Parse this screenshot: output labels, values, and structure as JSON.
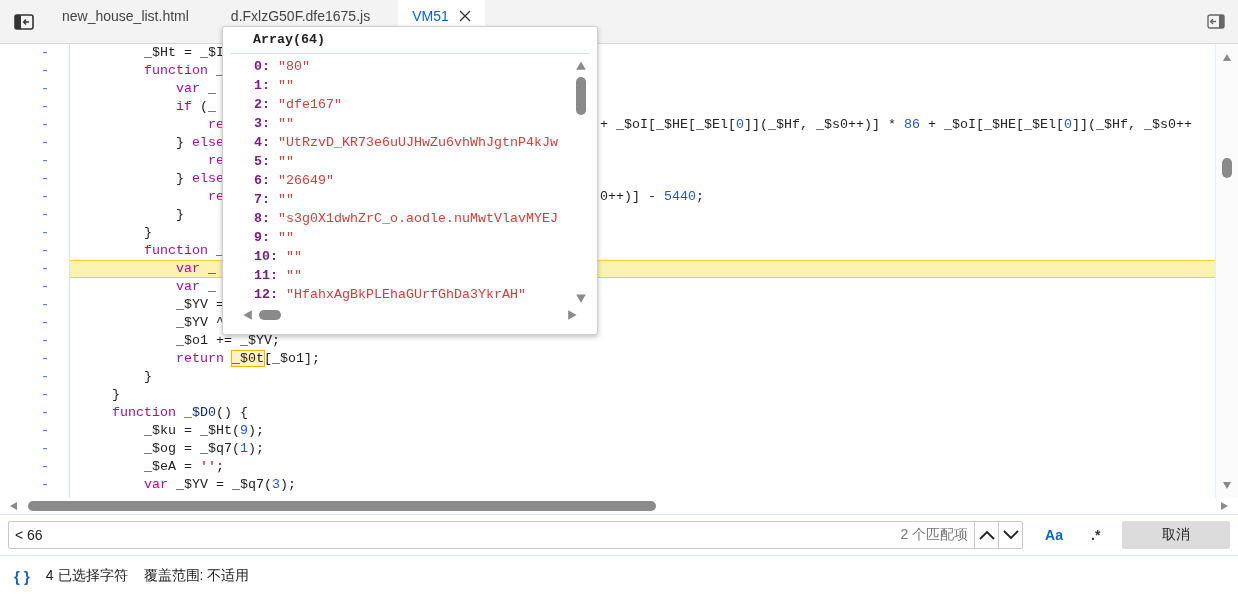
{
  "tabs": [
    {
      "label": "new_house_list.html",
      "selected": false,
      "closable": false
    },
    {
      "label": "d.FxlzG50F.dfe1675.js",
      "selected": false,
      "closable": false
    },
    {
      "label": "VM51",
      "selected": true,
      "closable": true
    }
  ],
  "editor": {
    "lines": [
      {
        "marker": "-",
        "highlighted": false,
        "tokens": [
          {
            "t": "        _$Ht = _$I"
          }
        ]
      },
      {
        "marker": "-",
        "highlighted": false,
        "tokens": [
          {
            "t": "        function",
            "kind": "keyword"
          },
          {
            "t": " _"
          }
        ]
      },
      {
        "marker": "-",
        "highlighted": false,
        "tokens": [
          {
            "t": "            var",
            "kind": "keyword"
          },
          {
            "t": " _"
          }
        ]
      },
      {
        "marker": "-",
        "highlighted": false,
        "tokens": [
          {
            "t": "            if",
            "kind": "keyword"
          },
          {
            "t": " (_"
          }
        ]
      },
      {
        "marker": "-",
        "highlighted": false,
        "tokens": [
          {
            "t": "                re",
            "kind": "keyword"
          }
        ],
        "right": [
          {
            "t": "+ _$oI[_$HE[_$El["
          },
          {
            "t": "0",
            "kind": "number"
          },
          {
            "t": "]](_$Hf, _$s0++)] * "
          },
          {
            "t": "86",
            "kind": "number"
          },
          {
            "t": " + _$oI[_$HE[_$El["
          },
          {
            "t": "0",
            "kind": "number"
          },
          {
            "t": "]](_$Hf, _$s0++"
          }
        ]
      },
      {
        "marker": "-",
        "highlighted": false,
        "tokens": [
          {
            "t": "            } "
          },
          {
            "t": "else",
            "kind": "keyword"
          }
        ]
      },
      {
        "marker": "-",
        "highlighted": false,
        "tokens": [
          {
            "t": "                re",
            "kind": "keyword"
          }
        ]
      },
      {
        "marker": "-",
        "highlighted": false,
        "tokens": [
          {
            "t": "            } "
          },
          {
            "t": "else",
            "kind": "keyword"
          }
        ]
      },
      {
        "marker": "-",
        "highlighted": false,
        "tokens": [
          {
            "t": "                re",
            "kind": "keyword"
          }
        ],
        "right": [
          {
            "t": "0++)] - "
          },
          {
            "t": "5440",
            "kind": "number"
          },
          {
            "t": ";"
          }
        ]
      },
      {
        "marker": "-",
        "highlighted": false,
        "tokens": [
          {
            "t": "            }"
          }
        ]
      },
      {
        "marker": "-",
        "highlighted": false,
        "tokens": [
          {
            "t": "        }"
          }
        ]
      },
      {
        "marker": "-",
        "highlighted": false,
        "tokens": [
          {
            "t": "        function",
            "kind": "keyword"
          },
          {
            "t": " _"
          }
        ]
      },
      {
        "marker": "-",
        "highlighted": true,
        "tokens": [
          {
            "t": "            var",
            "kind": "keyword"
          },
          {
            "t": " _"
          }
        ]
      },
      {
        "marker": "-",
        "highlighted": false,
        "tokens": [
          {
            "t": "            var",
            "kind": "keyword"
          },
          {
            "t": " _"
          }
        ]
      },
      {
        "marker": "-",
        "highlighted": false,
        "tokens": [
          {
            "t": "            _$YV ="
          }
        ]
      },
      {
        "marker": "-",
        "highlighted": false,
        "tokens": [
          {
            "t": "            _$YV ^"
          }
        ]
      },
      {
        "marker": "-",
        "highlighted": false,
        "tokens": [
          {
            "t": "            _$o1 += _$YV;"
          }
        ]
      },
      {
        "marker": "-",
        "highlighted": false,
        "tokens": [
          {
            "t": "            return ",
            "kind": "keyword"
          },
          {
            "t": "_$0t",
            "kind": "match"
          },
          {
            "t": "[_$o1];"
          }
        ]
      },
      {
        "marker": "-",
        "highlighted": false,
        "tokens": [
          {
            "t": "        }"
          }
        ]
      },
      {
        "marker": "-",
        "highlighted": false,
        "tokens": [
          {
            "t": "    }"
          }
        ]
      },
      {
        "marker": "-",
        "highlighted": false,
        "tokens": [
          {
            "t": "    function ",
            "kind": "keyword"
          },
          {
            "t": "_$D0",
            "kind": "name"
          },
          {
            "t": "() {"
          }
        ]
      },
      {
        "marker": "-",
        "highlighted": false,
        "tokens": [
          {
            "t": "        _$ku = _$Ht("
          },
          {
            "t": "9",
            "kind": "number"
          },
          {
            "t": ");"
          }
        ]
      },
      {
        "marker": "-",
        "highlighted": false,
        "tokens": [
          {
            "t": "        _$og = _$q7("
          },
          {
            "t": "1",
            "kind": "number"
          },
          {
            "t": ");"
          }
        ]
      },
      {
        "marker": "-",
        "highlighted": false,
        "tokens": [
          {
            "t": "        _$eA = "
          },
          {
            "t": "''",
            "kind": "string"
          },
          {
            "t": ";"
          }
        ]
      },
      {
        "marker": "-",
        "highlighted": false,
        "tokens": [
          {
            "t": "        var",
            "kind": "keyword"
          },
          {
            "t": " _$YV = _$q7("
          },
          {
            "t": "3",
            "kind": "number"
          },
          {
            "t": ");"
          }
        ]
      }
    ]
  },
  "popover": {
    "title": "Array(64)",
    "entries": [
      {
        "key": "0:",
        "value": "\"80\""
      },
      {
        "key": "1:",
        "value": "\"\""
      },
      {
        "key": "2:",
        "value": "\"dfe167\""
      },
      {
        "key": "3:",
        "value": "\"\""
      },
      {
        "key": "4:",
        "value": "\"UtRzvD_KR73e6uUJHwZu6vhWhJgtnP4kJw"
      },
      {
        "key": "5:",
        "value": "\"\""
      },
      {
        "key": "6:",
        "value": "\"26649\""
      },
      {
        "key": "7:",
        "value": "\"\""
      },
      {
        "key": "8:",
        "value": "\"s3g0X1dwhZrC_o.aodle.nuMwtVlavMYEJ"
      },
      {
        "key": "9:",
        "value": "\"\""
      },
      {
        "key": "10:",
        "value": "\"\""
      },
      {
        "key": "11:",
        "value": "\"\""
      },
      {
        "key": "12:",
        "value": "\"HfahxAgBkPLEhaGUrfGhDa3YkrAH\""
      }
    ]
  },
  "search": {
    "value": "< 66",
    "match_count": "2 个匹配项",
    "toggles": [
      {
        "label": "Aa",
        "selected": true
      },
      {
        "label": ".*",
        "selected": false
      }
    ],
    "cancel": "取消"
  },
  "status_bar": {
    "format_button": "{ }",
    "selection": "4 已选择字符",
    "coverage": "覆盖范围: 不适用"
  }
}
